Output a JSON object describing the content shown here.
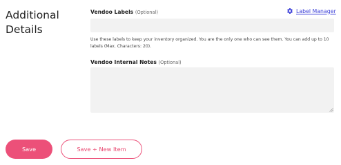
{
  "section": {
    "title_line1": "Additional",
    "title_line2": "Details"
  },
  "labels_field": {
    "label": "Vendoo Labels",
    "optional": "(Optional)",
    "value": "",
    "help_text": "Use these labels to keep your inventory organized. You are the only one who can see them. You can add up to 10 labels (Max. Characters: 20)."
  },
  "label_manager": {
    "icon": "gear-icon",
    "text": "Label Manager",
    "color": "#3b3fd8"
  },
  "notes_field": {
    "label": "Vendoo Internal Notes",
    "optional": "(Optional)",
    "value": ""
  },
  "actions": {
    "save_label": "Save",
    "save_new_label": "Save + New Item",
    "accent_color": "#ec5079"
  }
}
